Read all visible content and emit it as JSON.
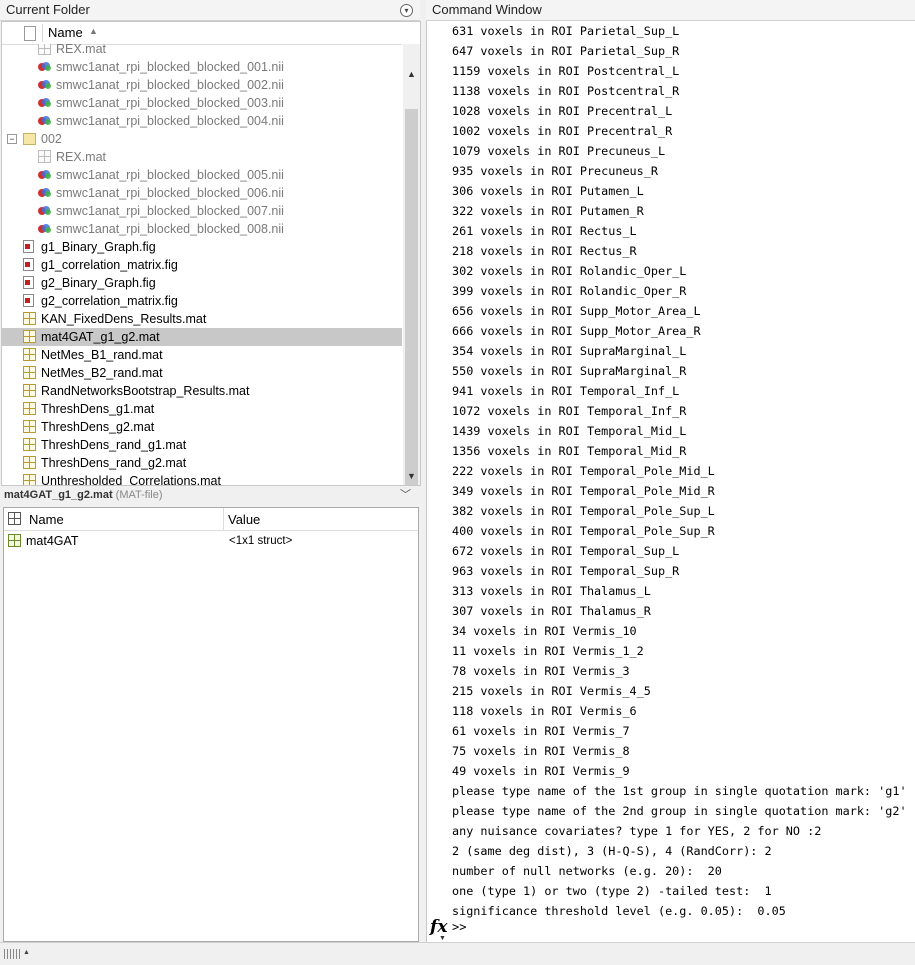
{
  "current_folder": {
    "title": "Current Folder",
    "column_name": "Name",
    "items": [
      {
        "label": "REX.mat",
        "icon": "mat-icon",
        "kind": "mat-gray",
        "indent": 2,
        "gray": true
      },
      {
        "label": "smwc1anat_rpi_blocked_blocked_001.nii",
        "icon": "nifti-icon",
        "kind": "nii",
        "indent": 2,
        "gray": true
      },
      {
        "label": "smwc1anat_rpi_blocked_blocked_002.nii",
        "icon": "nifti-icon",
        "kind": "nii",
        "indent": 2,
        "gray": true
      },
      {
        "label": "smwc1anat_rpi_blocked_blocked_003.nii",
        "icon": "nifti-icon",
        "kind": "nii",
        "indent": 2,
        "gray": true
      },
      {
        "label": "smwc1anat_rpi_blocked_blocked_004.nii",
        "icon": "nifti-icon",
        "kind": "nii",
        "indent": 2,
        "gray": true
      },
      {
        "label": "002",
        "icon": "folder-icon",
        "kind": "folder",
        "indent": 1,
        "gray": true,
        "expander": "−"
      },
      {
        "label": "REX.mat",
        "icon": "mat-icon",
        "kind": "mat-gray",
        "indent": 2,
        "gray": true
      },
      {
        "label": "smwc1anat_rpi_blocked_blocked_005.nii",
        "icon": "nifti-icon",
        "kind": "nii",
        "indent": 2,
        "gray": true
      },
      {
        "label": "smwc1anat_rpi_blocked_blocked_006.nii",
        "icon": "nifti-icon",
        "kind": "nii",
        "indent": 2,
        "gray": true
      },
      {
        "label": "smwc1anat_rpi_blocked_blocked_007.nii",
        "icon": "nifti-icon",
        "kind": "nii",
        "indent": 2,
        "gray": true
      },
      {
        "label": "smwc1anat_rpi_blocked_blocked_008.nii",
        "icon": "nifti-icon",
        "kind": "nii",
        "indent": 2,
        "gray": true
      },
      {
        "label": "g1_Binary_Graph.fig",
        "icon": "figure-file-icon",
        "kind": "fig",
        "indent": 1
      },
      {
        "label": "g1_correlation_matrix.fig",
        "icon": "figure-file-icon",
        "kind": "fig",
        "indent": 1
      },
      {
        "label": "g2_Binary_Graph.fig",
        "icon": "figure-file-icon",
        "kind": "fig",
        "indent": 1
      },
      {
        "label": "g2_correlation_matrix.fig",
        "icon": "figure-file-icon",
        "kind": "fig",
        "indent": 1
      },
      {
        "label": "KAN_FixedDens_Results.mat",
        "icon": "mat-icon",
        "kind": "mat",
        "indent": 1
      },
      {
        "label": "mat4GAT_g1_g2.mat",
        "icon": "mat-icon",
        "kind": "mat",
        "indent": 1,
        "selected": true
      },
      {
        "label": "NetMes_B1_rand.mat",
        "icon": "mat-icon",
        "kind": "mat",
        "indent": 1
      },
      {
        "label": "NetMes_B2_rand.mat",
        "icon": "mat-icon",
        "kind": "mat",
        "indent": 1
      },
      {
        "label": "RandNetworksBootstrap_Results.mat",
        "icon": "mat-icon",
        "kind": "mat",
        "indent": 1
      },
      {
        "label": "ThreshDens_g1.mat",
        "icon": "mat-icon",
        "kind": "mat",
        "indent": 1
      },
      {
        "label": "ThreshDens_g2.mat",
        "icon": "mat-icon",
        "kind": "mat",
        "indent": 1
      },
      {
        "label": "ThreshDens_rand_g1.mat",
        "icon": "mat-icon",
        "kind": "mat",
        "indent": 1
      },
      {
        "label": "ThreshDens_rand_g2.mat",
        "icon": "mat-icon",
        "kind": "mat",
        "indent": 1
      },
      {
        "label": "Unthresholded_Correlations.mat",
        "icon": "mat-icon",
        "kind": "mat",
        "indent": 1
      }
    ]
  },
  "details": {
    "filename": "mat4GAT_g1_g2.mat",
    "filetype": "(MAT-file)",
    "col_name": "Name",
    "col_value": "Value",
    "rows": [
      {
        "name": "mat4GAT",
        "value": "<1x1 struct>"
      }
    ]
  },
  "command_window": {
    "title": "Command Window",
    "lines": [
      "631 voxels in ROI Parietal_Sup_L",
      "647 voxels in ROI Parietal_Sup_R",
      "1159 voxels in ROI Postcentral_L",
      "1138 voxels in ROI Postcentral_R",
      "1028 voxels in ROI Precentral_L",
      "1002 voxels in ROI Precentral_R",
      "1079 voxels in ROI Precuneus_L",
      "935 voxels in ROI Precuneus_R",
      "306 voxels in ROI Putamen_L",
      "322 voxels in ROI Putamen_R",
      "261 voxels in ROI Rectus_L",
      "218 voxels in ROI Rectus_R",
      "302 voxels in ROI Rolandic_Oper_L",
      "399 voxels in ROI Rolandic_Oper_R",
      "656 voxels in ROI Supp_Motor_Area_L",
      "666 voxels in ROI Supp_Motor_Area_R",
      "354 voxels in ROI SupraMarginal_L",
      "550 voxels in ROI SupraMarginal_R",
      "941 voxels in ROI Temporal_Inf_L",
      "1072 voxels in ROI Temporal_Inf_R",
      "1439 voxels in ROI Temporal_Mid_L",
      "1356 voxels in ROI Temporal_Mid_R",
      "222 voxels in ROI Temporal_Pole_Mid_L",
      "349 voxels in ROI Temporal_Pole_Mid_R",
      "382 voxels in ROI Temporal_Pole_Sup_L",
      "400 voxels in ROI Temporal_Pole_Sup_R",
      "672 voxels in ROI Temporal_Sup_L",
      "963 voxels in ROI Temporal_Sup_R",
      "313 voxels in ROI Thalamus_L",
      "307 voxels in ROI Thalamus_R",
      "34 voxels in ROI Vermis_10",
      "11 voxels in ROI Vermis_1_2",
      "78 voxels in ROI Vermis_3",
      "215 voxels in ROI Vermis_4_5",
      "118 voxels in ROI Vermis_6",
      "61 voxels in ROI Vermis_7",
      "75 voxels in ROI Vermis_8",
      "49 voxels in ROI Vermis_9",
      "please type name of the 1st group in single quotation mark: 'g1'",
      "please type name of the 2nd group in single quotation mark: 'g2'",
      "any nuisance covariates? type 1 for YES, 2 for NO :2",
      "2 (same deg dist), 3 (H-Q-S), 4 (RandCorr): 2",
      "number of null networks (e.g. 20):  20",
      "one (type 1) or two (type 2) -tailed test:  1",
      "significance threshold level (e.g. 0.05):  0.05"
    ],
    "fx_label": "fx",
    "prompt": ">>"
  }
}
